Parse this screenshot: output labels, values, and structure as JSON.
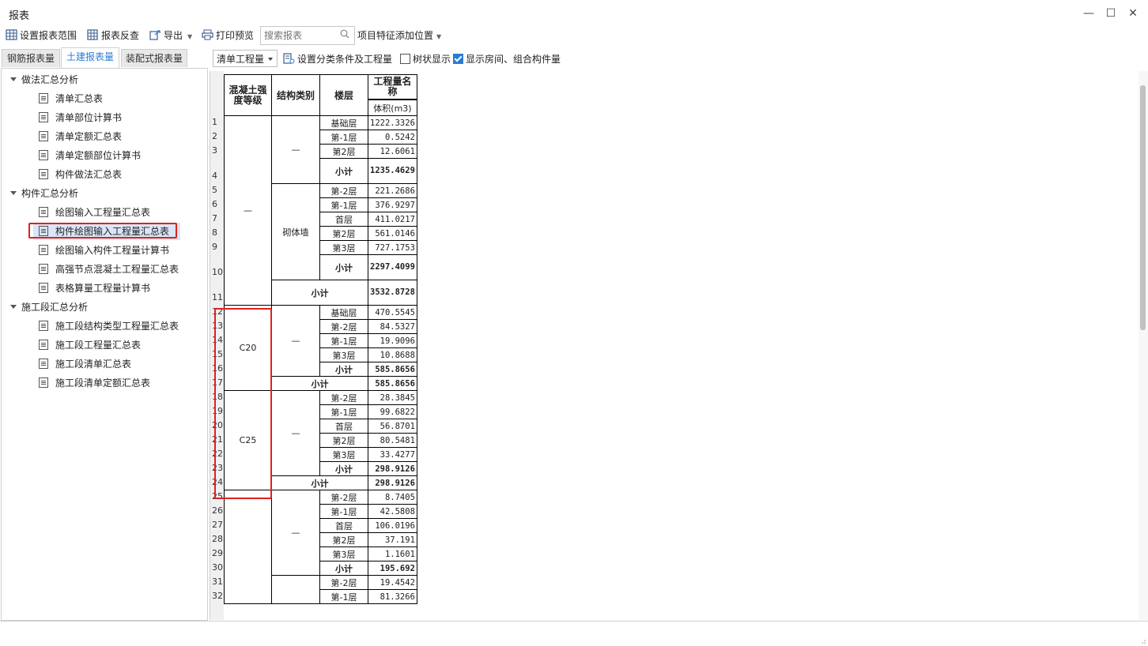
{
  "window": {
    "title": "报表",
    "min_icon": "minimize-icon",
    "max_icon": "maximize-icon",
    "close_icon": "close-icon"
  },
  "toolbar": {
    "set_range": "设置报表范围",
    "reverse_check": "报表反查",
    "export": "导出",
    "print_preview": "打印预览",
    "search_placeholder": "搜索报表",
    "feature_pos": "项目特征添加位置"
  },
  "tabs": [
    {
      "label": "钢筋报表量"
    },
    {
      "label": "土建报表量",
      "active": true
    },
    {
      "label": "装配式报表量"
    }
  ],
  "tree": {
    "groups": [
      {
        "label": "做法汇总分析",
        "items": [
          "清单汇总表",
          "清单部位计算书",
          "清单定额汇总表",
          "清单定额部位计算书",
          "构件做法汇总表"
        ]
      },
      {
        "label": "构件汇总分析",
        "items": [
          "绘图输入工程量汇总表",
          "构件绘图输入工程量汇总表",
          "绘图输入构件工程量计算书",
          "高强节点混凝土工程量汇总表",
          "表格算量工程量计算书"
        ]
      },
      {
        "label": "施工段汇总分析",
        "items": [
          "施工段结构类型工程量汇总表",
          "施工段工程量汇总表",
          "施工段清单汇总表",
          "施工段清单定额汇总表"
        ]
      }
    ],
    "selected": "构件绘图输入工程量汇总表"
  },
  "report_toolbar": {
    "quantity_select": "清单工程量",
    "set_conditions": "设置分类条件及工程量",
    "tree_display": "树状显示",
    "tree_display_checked": false,
    "show_rooms": "显示房间、组合构件量",
    "show_rooms_checked": true
  },
  "report": {
    "headers": {
      "grade": "混凝土强度等级",
      "struct_type": "结构类别",
      "floor": "楼层",
      "qty_name": "工程量名称",
      "volume": "体积(m3)"
    },
    "subtotal": "小计",
    "dash": "—",
    "masonry": "砌体墙",
    "c20": "C20",
    "c25": "C25",
    "rows": [
      {
        "n": "1",
        "floor": "基础层",
        "v": "1222.3326"
      },
      {
        "n": "2",
        "floor": "第-1层",
        "v": "0.5242"
      },
      {
        "n": "3",
        "floor": "第2层",
        "v": "12.6061"
      },
      {
        "n": "4",
        "floor": "小计",
        "v": "1235.4629"
      },
      {
        "n": "5",
        "floor": "第-2层",
        "v": "221.2686"
      },
      {
        "n": "6",
        "floor": "第-1层",
        "v": "376.9297"
      },
      {
        "n": "7",
        "floor": "首层",
        "v": "411.0217"
      },
      {
        "n": "8",
        "floor": "第2层",
        "v": "561.0146"
      },
      {
        "n": "9",
        "floor": "第3层",
        "v": "727.1753"
      },
      {
        "n": "10",
        "floor": "小计",
        "v": "2297.4099"
      },
      {
        "n": "11",
        "floor": "小计",
        "v": "3532.8728"
      },
      {
        "n": "12",
        "floor": "基础层",
        "v": "470.5545"
      },
      {
        "n": "13",
        "floor": "第-2层",
        "v": "84.5327"
      },
      {
        "n": "14",
        "floor": "第-1层",
        "v": "19.9096"
      },
      {
        "n": "15",
        "floor": "第3层",
        "v": "10.8688"
      },
      {
        "n": "16",
        "floor": "小计",
        "v": "585.8656"
      },
      {
        "n": "17",
        "floor": "小计",
        "v": "585.8656"
      },
      {
        "n": "18",
        "floor": "第-2层",
        "v": "28.3845"
      },
      {
        "n": "19",
        "floor": "第-1层",
        "v": "99.6822"
      },
      {
        "n": "20",
        "floor": "首层",
        "v": "56.8701"
      },
      {
        "n": "21",
        "floor": "第2层",
        "v": "80.5481"
      },
      {
        "n": "22",
        "floor": "第3层",
        "v": "33.4277"
      },
      {
        "n": "23",
        "floor": "小计",
        "v": "298.9126"
      },
      {
        "n": "24",
        "floor": "小计",
        "v": "298.9126"
      },
      {
        "n": "25",
        "floor": "第-2层",
        "v": "8.7405"
      },
      {
        "n": "26",
        "floor": "第-1层",
        "v": "42.5808"
      },
      {
        "n": "27",
        "floor": "首层",
        "v": "106.0196"
      },
      {
        "n": "28",
        "floor": "第2层",
        "v": "37.191"
      },
      {
        "n": "29",
        "floor": "第3层",
        "v": "1.1601"
      },
      {
        "n": "30",
        "floor": "小计",
        "v": "195.692"
      },
      {
        "n": "31",
        "floor": "第-2层",
        "v": "19.4542"
      },
      {
        "n": "32",
        "floor": "第-1层",
        "v": "81.3266"
      }
    ]
  },
  "colors": {
    "accent": "#2b7bd6",
    "highlight_red": "#e02020",
    "selected_bg": "#d9e6f7"
  }
}
